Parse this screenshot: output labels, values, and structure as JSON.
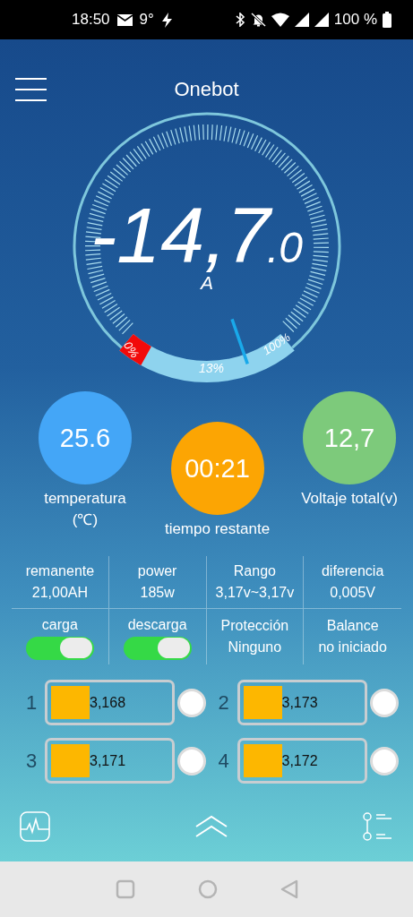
{
  "status_bar": {
    "time": "18:50",
    "temperature": "9°",
    "battery": "100 %"
  },
  "header": {
    "title": "Onebot"
  },
  "gauge": {
    "value": "-14,7",
    "decimals": ".0",
    "unit": "A",
    "labels": [
      "0%",
      "13%",
      "100%"
    ]
  },
  "readings": [
    {
      "value": "25.6",
      "label": [
        "temperatura",
        "(℃)"
      ],
      "color": "#44a6f7"
    },
    {
      "value": "00:21",
      "label": [
        "tiempo restante"
      ],
      "color": "#fca503"
    },
    {
      "value": "12,7",
      "label": [
        "Voltaje total(v)"
      ],
      "color": "#7dca7b"
    }
  ],
  "stats": [
    {
      "kind": "text",
      "label": "remanente",
      "value": "21,00AH"
    },
    {
      "kind": "text",
      "label": "power",
      "value": "185w"
    },
    {
      "kind": "text",
      "label": "Rango",
      "value": "3,17v~3,17v"
    },
    {
      "kind": "text",
      "label": "diferencia",
      "value": "0,005V"
    },
    {
      "kind": "toggle",
      "label": "carga",
      "on": true
    },
    {
      "kind": "toggle",
      "label": "descarga",
      "on": true
    },
    {
      "kind": "text",
      "label": "Protección",
      "value": "Ninguno"
    },
    {
      "kind": "text",
      "label": "Balance",
      "value": "no iniciado"
    }
  ],
  "cells": [
    {
      "number": "1",
      "value": "3,168"
    },
    {
      "number": "2",
      "value": "3,173"
    },
    {
      "number": "3",
      "value": "3,171"
    },
    {
      "number": "4",
      "value": "3,172"
    }
  ]
}
